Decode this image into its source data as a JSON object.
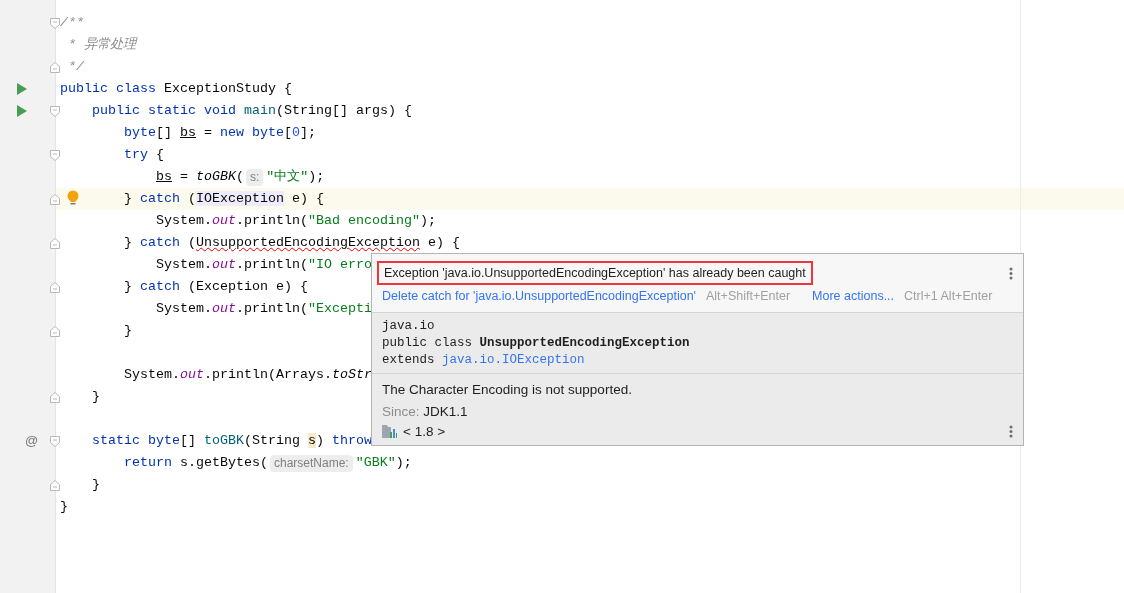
{
  "editor": {
    "lines": [
      {
        "current": false,
        "gutter": [
          {
            "kind": "fold_start"
          }
        ],
        "segments": [
          {
            "kind": "code",
            "tokens": [
              {
                "text": "/**",
                "kind": "comment"
              }
            ]
          }
        ]
      },
      {
        "current": false,
        "segments": [
          {
            "kind": "code",
            "tokens": [
              {
                "text": " * 异常处理",
                "kind": "comment"
              }
            ]
          }
        ]
      },
      {
        "current": false,
        "gutter": [
          {
            "kind": "fold_end"
          }
        ],
        "segments": [
          {
            "kind": "code",
            "tokens": [
              {
                "text": " */",
                "kind": "comment"
              }
            ]
          }
        ]
      },
      {
        "current": false,
        "gutter": [
          {
            "kind": "run"
          }
        ],
        "segments": [
          {
            "kind": "code",
            "tokens": [
              {
                "text": "public class ",
                "kind": "kw"
              },
              {
                "text": "ExceptionStudy {",
                "kind": "plain"
              }
            ]
          }
        ]
      },
      {
        "current": false,
        "gutter": [
          {
            "kind": "run"
          },
          {
            "kind": "fold_start"
          }
        ],
        "segments": [
          {
            "kind": "code",
            "tokens": [
              {
                "text": "    public static void ",
                "kind": "kw"
              },
              {
                "text": "main",
                "kind": "decl"
              },
              {
                "text": "(String[] args) {",
                "kind": "plain"
              }
            ]
          }
        ]
      },
      {
        "current": false,
        "segments": [
          {
            "kind": "code",
            "tokens": [
              {
                "text": "        byte",
                "kind": "kw"
              },
              {
                "text": "[] ",
                "kind": "plain"
              },
              {
                "text": "bs",
                "kind": "underlined"
              },
              {
                "text": " = ",
                "kind": "plain"
              },
              {
                "text": "new byte",
                "kind": "kw"
              },
              {
                "text": "[",
                "kind": "plain"
              },
              {
                "text": "0",
                "kind": "num"
              },
              {
                "text": "];",
                "kind": "plain"
              }
            ]
          }
        ]
      },
      {
        "current": false,
        "gutter": [
          {
            "kind": "fold_start"
          }
        ],
        "segments": [
          {
            "kind": "code",
            "tokens": [
              {
                "text": "        try ",
                "kind": "kw"
              },
              {
                "text": "{",
                "kind": "plain"
              }
            ]
          }
        ]
      },
      {
        "current": false,
        "segments": [
          {
            "kind": "code",
            "tokens": [
              {
                "text": "            bs",
                "kind": "underlined"
              },
              {
                "text": " = ",
                "kind": "plain"
              },
              {
                "text": "toGBK",
                "kind": "italic"
              },
              {
                "text": "(",
                "kind": "plain"
              }
            ]
          },
          {
            "kind": "hint",
            "text": "s:"
          },
          {
            "kind": "code",
            "tokens": [
              {
                "text": "\"中文\"",
                "kind": "str"
              },
              {
                "text": ");",
                "kind": "plain"
              }
            ]
          }
        ]
      },
      {
        "current": true,
        "gutter": [
          {
            "kind": "fold_end"
          },
          {
            "kind": "bulb"
          }
        ],
        "segments": [
          {
            "kind": "code",
            "tokens": [
              {
                "text": "        } ",
                "kind": "plain"
              },
              {
                "text": "catch ",
                "kind": "kw"
              },
              {
                "text": "(",
                "kind": "plain"
              },
              {
                "text": "IOException",
                "kind": "highlight"
              },
              {
                "text": " e) {",
                "kind": "plain"
              }
            ]
          }
        ]
      },
      {
        "current": false,
        "segments": [
          {
            "kind": "code",
            "tokens": [
              {
                "text": "            System.",
                "kind": "plain"
              },
              {
                "text": "out",
                "kind": "field"
              },
              {
                "text": ".println(",
                "kind": "plain"
              },
              {
                "text": "\"Bad encoding\"",
                "kind": "str"
              },
              {
                "text": ");",
                "kind": "plain"
              }
            ]
          }
        ]
      },
      {
        "current": false,
        "gutter": [
          {
            "kind": "fold_end"
          }
        ],
        "segments": [
          {
            "kind": "code",
            "tokens": [
              {
                "text": "        } ",
                "kind": "plain"
              },
              {
                "text": "catch ",
                "kind": "kw"
              },
              {
                "text": "(",
                "kind": "plain"
              },
              {
                "text": "UnsupportedEncodingException",
                "kind": "error"
              },
              {
                "text": " e) {",
                "kind": "plain"
              }
            ]
          }
        ]
      },
      {
        "current": false,
        "segments": [
          {
            "kind": "code",
            "tokens": [
              {
                "text": "            System.",
                "kind": "plain"
              },
              {
                "text": "out",
                "kind": "field"
              },
              {
                "text": ".println(",
                "kind": "plain"
              },
              {
                "text": "\"IO erro",
                "kind": "str"
              }
            ]
          }
        ]
      },
      {
        "current": false,
        "gutter": [
          {
            "kind": "fold_end"
          }
        ],
        "segments": [
          {
            "kind": "code",
            "tokens": [
              {
                "text": "        } ",
                "kind": "plain"
              },
              {
                "text": "catch ",
                "kind": "kw"
              },
              {
                "text": "(Exception e) {",
                "kind": "plain"
              }
            ]
          }
        ]
      },
      {
        "current": false,
        "segments": [
          {
            "kind": "code",
            "tokens": [
              {
                "text": "            System.",
                "kind": "plain"
              },
              {
                "text": "out",
                "kind": "field"
              },
              {
                "text": ".println(",
                "kind": "plain"
              },
              {
                "text": "\"Excepti",
                "kind": "str"
              }
            ]
          }
        ]
      },
      {
        "current": false,
        "gutter": [
          {
            "kind": "fold_end"
          }
        ],
        "segments": [
          {
            "kind": "code",
            "tokens": [
              {
                "text": "        }",
                "kind": "plain"
              }
            ]
          }
        ]
      },
      {
        "current": false
      },
      {
        "current": false,
        "segments": [
          {
            "kind": "code",
            "tokens": [
              {
                "text": "        System.",
                "kind": "plain"
              },
              {
                "text": "out",
                "kind": "field"
              },
              {
                "text": ".println(Arrays.",
                "kind": "plain"
              },
              {
                "text": "toStr",
                "kind": "italic"
              }
            ]
          }
        ]
      },
      {
        "current": false,
        "gutter": [
          {
            "kind": "fold_end"
          }
        ],
        "segments": [
          {
            "kind": "code",
            "tokens": [
              {
                "text": "    }",
                "kind": "plain"
              }
            ]
          }
        ]
      },
      {
        "current": false
      },
      {
        "current": false,
        "gutter": [
          {
            "kind": "at",
            "text": "@"
          },
          {
            "kind": "fold_start"
          }
        ],
        "segments": [
          {
            "kind": "code",
            "tokens": [
              {
                "text": "    static byte",
                "kind": "kw"
              },
              {
                "text": "[] ",
                "kind": "plain"
              },
              {
                "text": "toGBK",
                "kind": "decl"
              },
              {
                "text": "(String ",
                "kind": "plain"
              },
              {
                "text": "s",
                "kind": "param"
              },
              {
                "text": ") ",
                "kind": "plain"
              },
              {
                "text": "throw",
                "kind": "kw"
              }
            ]
          }
        ]
      },
      {
        "current": false,
        "segments": [
          {
            "kind": "code",
            "tokens": [
              {
                "text": "        return ",
                "kind": "kw"
              },
              {
                "text": "s.getBytes(",
                "kind": "plain"
              }
            ]
          },
          {
            "kind": "hint",
            "text": "charsetName:"
          },
          {
            "kind": "code",
            "tokens": [
              {
                "text": "\"GBK\"",
                "kind": "str"
              },
              {
                "text": ");",
                "kind": "plain"
              }
            ]
          }
        ]
      },
      {
        "current": false,
        "gutter": [
          {
            "kind": "fold_end"
          }
        ],
        "segments": [
          {
            "kind": "code",
            "tokens": [
              {
                "text": "    }",
                "kind": "plain"
              }
            ]
          }
        ]
      },
      {
        "current": false,
        "segments": [
          {
            "kind": "code",
            "tokens": [
              {
                "text": "}",
                "kind": "plain"
              }
            ]
          }
        ]
      }
    ]
  },
  "popup": {
    "problem": {
      "text": "Exception 'java.io.UnsupportedEncodingException' has already been caught",
      "annotated": true
    },
    "actions": [
      {
        "label": "Delete catch for 'java.io.UnsupportedEncodingException'",
        "shortcut": "Alt+Shift+Enter"
      },
      {
        "label": "More actions...",
        "shortcut": "Ctrl+1 Alt+Enter"
      }
    ],
    "doc": {
      "package": "java.io",
      "declaration": "public class **UnsupportedEncodingException**",
      "extends_keyword": "extends",
      "extends_link": "java.io.IOException",
      "description": "The Character Encoding is not supported.",
      "since_label": "Since:",
      "since_value": "JDK1.1",
      "library": "< 1.8 >"
    }
  }
}
